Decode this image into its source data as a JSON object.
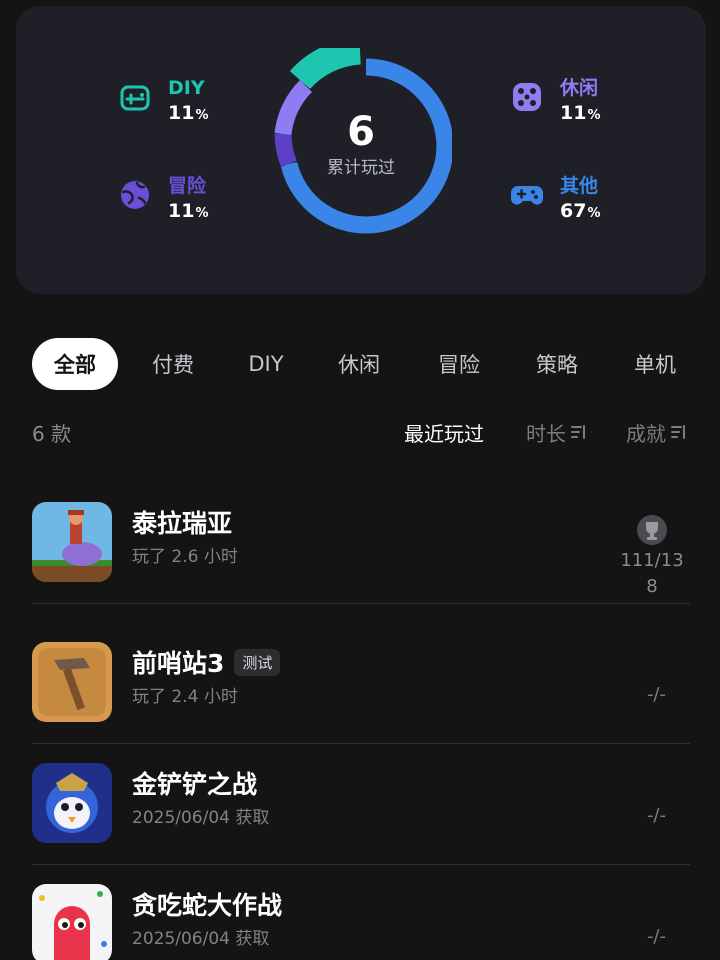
{
  "stats": {
    "total": "6",
    "total_label": "累计玩过",
    "categories": [
      {
        "name": "DIY",
        "pct": "11",
        "unit": "%",
        "color": "#1ec6b0",
        "icon": "gamepad-box-icon"
      },
      {
        "name": "冒险",
        "pct": "11",
        "unit": "%",
        "color": "#6a4ed8",
        "icon": "globe-icon"
      },
      {
        "name": "休闲",
        "pct": "11",
        "unit": "%",
        "color": "#8d7cf2",
        "icon": "dice-icon"
      },
      {
        "name": "其他",
        "pct": "67",
        "unit": "%",
        "color": "#3a86e8",
        "icon": "gamepad-icon"
      }
    ]
  },
  "tabs": [
    "全部",
    "付费",
    "DIY",
    "休闲",
    "冒险",
    "策略",
    "单机"
  ],
  "sortbar": {
    "count": "6 款",
    "recent": "最近玩过",
    "duration": "时长",
    "achievement": "成就"
  },
  "games": [
    {
      "title": "泰拉瑞亚",
      "sub": "玩了 2.6 小时",
      "badge": "",
      "achievement": "111/138",
      "ach_line1": "111/13",
      "ach_line2": "8"
    },
    {
      "title": "前哨站3",
      "sub": "玩了 2.4 小时",
      "badge": "测试",
      "achievement": "-/-"
    },
    {
      "title": "金铲铲之战",
      "sub": "2025/06/04 获取",
      "badge": "",
      "achievement": "-/-"
    },
    {
      "title": "贪吃蛇大作战",
      "sub": "2025/06/04 获取",
      "badge": "",
      "achievement": "-/-"
    }
  ]
}
